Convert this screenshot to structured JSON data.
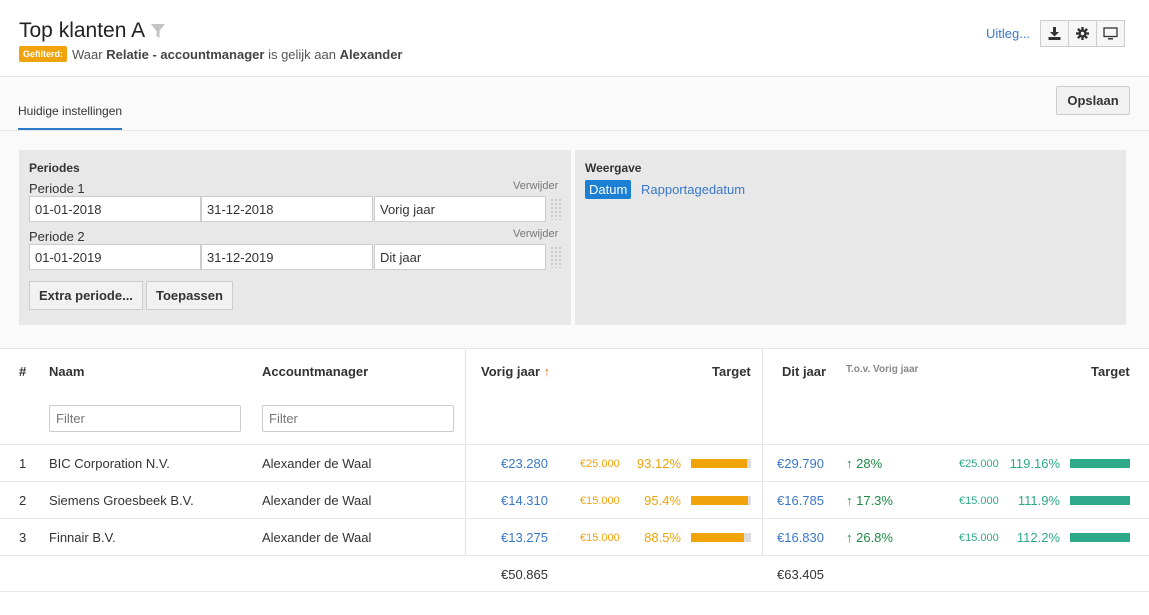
{
  "header": {
    "title": "Top klanten A",
    "filter_badge": "Gefilterd:",
    "filter_text_1": "Waar",
    "filter_field": "Relatie - accountmanager",
    "filter_text_2": "is gelijk aan",
    "filter_value": "Alexander",
    "help_link": "Uitleg..."
  },
  "tabs": {
    "current": "Huidige instellingen"
  },
  "toolbar": {
    "save_label": "Opslaan"
  },
  "periods": {
    "title": "Periodes",
    "remove_label": "Verwijder",
    "items": [
      {
        "label": "Periode 1",
        "start": "01-01-2018",
        "end": "31-12-2018",
        "name": "Vorig jaar"
      },
      {
        "label": "Periode 2",
        "start": "01-01-2019",
        "end": "31-12-2019",
        "name": "Dit jaar"
      }
    ],
    "extra_label": "Extra periode...",
    "apply_label": "Toepassen"
  },
  "display": {
    "title": "Weergave",
    "options": [
      "Datum",
      "Rapportagedatum"
    ],
    "selected": "Datum"
  },
  "table": {
    "headers": {
      "num": "#",
      "name": "Naam",
      "manager": "Accountmanager",
      "prev": "Vorig jaar",
      "sort_arrow": "↑",
      "prev_target": "Target",
      "curr": "Dit jaar",
      "vs_prev": "T.o.v. Vorig jaar",
      "curr_target": "Target"
    },
    "filter_placeholder": "Filter",
    "rows": [
      {
        "num": "1",
        "name": "BIC Corporation N.V.",
        "manager": "Alexander de Waal",
        "prev": "€23.280",
        "prev_target": "€25.000",
        "prev_pct": "93.12%",
        "prev_fill": 0.9312,
        "curr": "€29.790",
        "change": "↑ 28%",
        "curr_target": "€25.000",
        "curr_pct": "119.16%",
        "curr_fill": 1.0
      },
      {
        "num": "2",
        "name": "Siemens Groesbeek B.V.",
        "manager": "Alexander de Waal",
        "prev": "€14.310",
        "prev_target": "€15.000",
        "prev_pct": "95.4%",
        "prev_fill": 0.954,
        "curr": "€16.785",
        "change": "↑ 17.3%",
        "curr_target": "€15.000",
        "curr_pct": "111.9%",
        "curr_fill": 1.0
      },
      {
        "num": "3",
        "name": "Finnair B.V.",
        "manager": "Alexander de Waal",
        "prev": "€13.275",
        "prev_target": "€15.000",
        "prev_pct": "88.5%",
        "prev_fill": 0.885,
        "curr": "€16.830",
        "change": "↑ 26.8%",
        "curr_target": "€15.000",
        "curr_pct": "112.2%",
        "curr_fill": 1.0
      }
    ],
    "totals": {
      "prev": "€50.865",
      "curr": "€63.405"
    }
  },
  "colors": {
    "accent": "#1b7fd4",
    "link": "#3a78c9",
    "orange": "#f0a30a",
    "teal": "#2eaa8a",
    "green": "#1e8a46"
  }
}
